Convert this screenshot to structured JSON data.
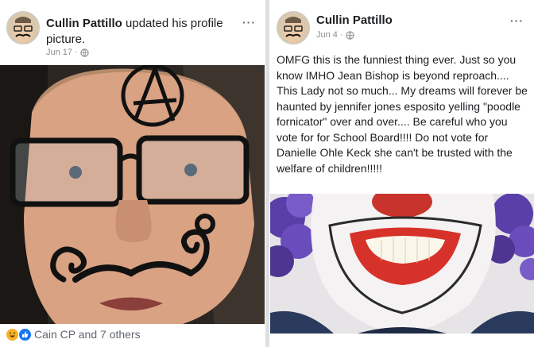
{
  "left_post": {
    "author_name": "Cullin Pattillo",
    "action_text": " updated his profile picture.",
    "timestamp": "Jun 17 ·",
    "privacy_icon": "globe-icon",
    "more_label": "···",
    "reactions_text": "Cain CP and 7 others",
    "reaction_icons": [
      "haha-icon",
      "like-icon"
    ]
  },
  "right_post": {
    "author_name": "Cullin Pattillo",
    "timestamp": "Jun 4 ·",
    "privacy_icon": "globe-icon",
    "more_label": "···",
    "body": "OMFG this is the funniest thing ever. Just so you know IMHO Jean Bishop is beyond reproach.... This Lady not so much... My dreams will forever be haunted by jennifer jones esposito yelling \"poodle fornicator\" over and over....  Be careful who you vote for for School Board!!!!   Do not vote for  Danielle Ohle Keck she can't be trusted with the welfare of children!!!!!"
  },
  "colors": {
    "text": "#1c1e21",
    "meta": "#8a8d91",
    "like_blue": "#1877f2",
    "haha_yellow": "#f7b125"
  }
}
